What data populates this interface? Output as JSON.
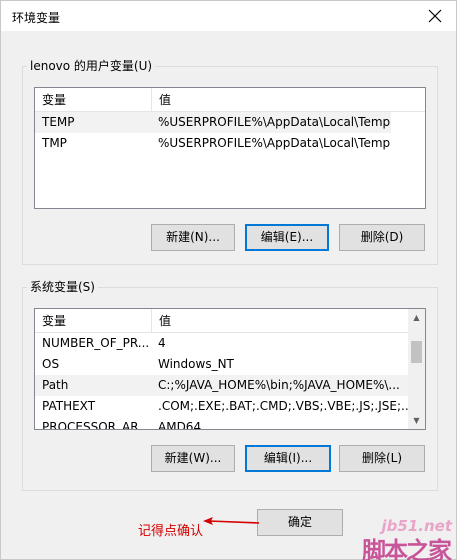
{
  "window": {
    "title": "环境变量",
    "close_icon": "close-icon"
  },
  "user_vars": {
    "group_label": "lenovo 的用户变量(U)",
    "columns": [
      "变量",
      "值"
    ],
    "rows": [
      {
        "name": "TEMP",
        "value": "%USERPROFILE%\\AppData\\Local\\Temp"
      },
      {
        "name": "TMP",
        "value": "%USERPROFILE%\\AppData\\Local\\Temp"
      }
    ],
    "buttons": {
      "new": "新建(N)...",
      "edit": "编辑(E)...",
      "delete": "删除(D)"
    }
  },
  "system_vars": {
    "group_label": "系统变量(S)",
    "columns": [
      "变量",
      "值"
    ],
    "rows": [
      {
        "name": "NUMBER_OF_PR...",
        "value": "4"
      },
      {
        "name": "OS",
        "value": "Windows_NT"
      },
      {
        "name": "Path",
        "value": "C:;%JAVA_HOME%\\bin;%JAVA_HOME%\\..."
      },
      {
        "name": "PATHEXT",
        "value": ".COM;.EXE;.BAT;.CMD;.VBS;.VBE;.JS;.JSE;..."
      },
      {
        "name": "PROCESSOR_AR...",
        "value": "AMD64"
      }
    ],
    "buttons": {
      "new": "新建(W)...",
      "edit": "编辑(I)...",
      "delete": "删除(L)"
    }
  },
  "footer": {
    "ok": "确定"
  },
  "annotation": {
    "text": "记得点确认",
    "color": "#d40000"
  },
  "watermark": {
    "url": "jb51.net",
    "text": "脚本之家"
  }
}
